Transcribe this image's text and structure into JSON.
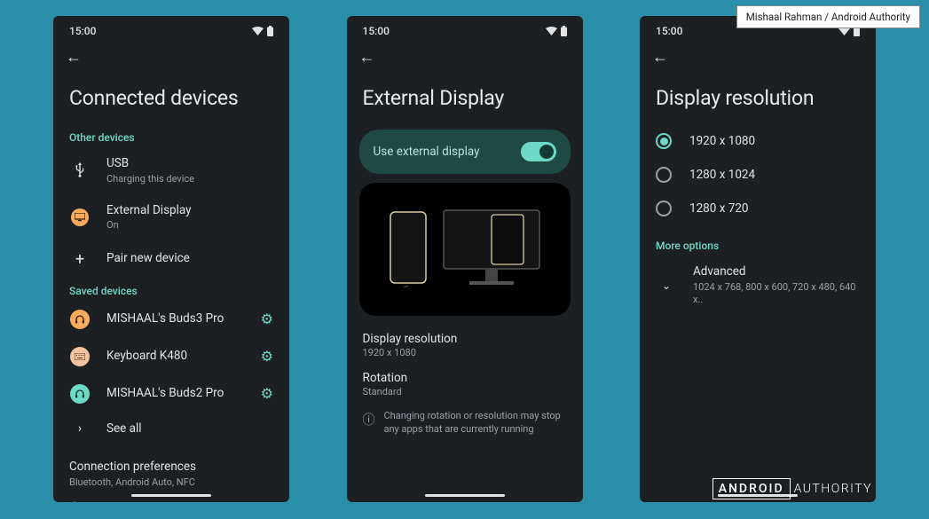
{
  "caption": "Mishaal Rahman / Android Authority",
  "watermark": {
    "boxed": "ANDROID",
    "rest": "AUTHORITY"
  },
  "status_time": "15:00",
  "screens": {
    "connected": {
      "title": "Connected devices",
      "sections": {
        "other": {
          "header": "Other devices",
          "usb": {
            "title": "USB",
            "sub": "Charging this device"
          },
          "external": {
            "title": "External Display",
            "sub": "On"
          },
          "pair": {
            "title": "Pair new device"
          }
        },
        "saved": {
          "header": "Saved devices",
          "items": [
            {
              "label": "MISHAAL's Buds3 Pro"
            },
            {
              "label": "Keyboard K480"
            },
            {
              "label": "MISHAAL's Buds2 Pro"
            }
          ],
          "see_all": "See all"
        },
        "prefs": {
          "title": "Connection preferences",
          "sub": "Bluetooth, Android Auto, NFC"
        }
      }
    },
    "external": {
      "title": "External Display",
      "toggle_label": "Use external display",
      "resolution": {
        "title": "Display resolution",
        "value": "1920 x 1080"
      },
      "rotation": {
        "title": "Rotation",
        "value": "Standard"
      },
      "warning": "Changing rotation or resolution may stop any apps that are currently running"
    },
    "resolution": {
      "title": "Display resolution",
      "options": [
        "1920 x 1080",
        "1280 x 1024",
        "1280 x 720"
      ],
      "more_header": "More options",
      "advanced": {
        "title": "Advanced",
        "sub": "1024 x 768, 800 x 600, 720 x 480, 640 x.."
      }
    }
  }
}
